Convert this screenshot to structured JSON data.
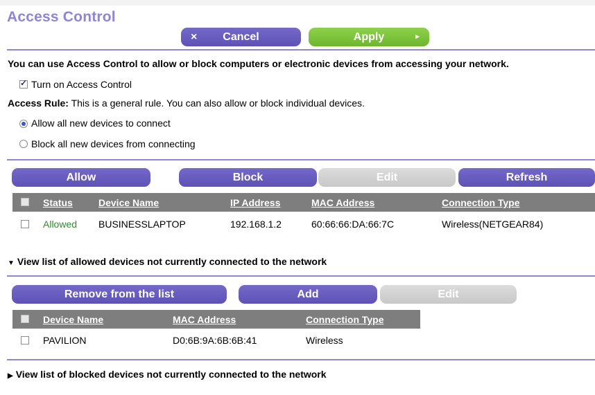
{
  "page": {
    "title": "Access Control"
  },
  "toolbar": {
    "cancel_label": "Cancel",
    "apply_label": "Apply",
    "cancel_icon": "×",
    "apply_icon": "►"
  },
  "intro": {
    "description": "You can use Access Control to allow or block computers or electronic devices from accessing your network.",
    "turn_on_label": "Turn on Access Control",
    "turn_on_checked": true,
    "rule_label": "Access Rule:",
    "rule_text": " This is a general rule. You can also allow or block individual devices.",
    "options": [
      {
        "label": "Allow all new devices to connect",
        "selected": true
      },
      {
        "label": "Block all new devices from connecting",
        "selected": false
      }
    ]
  },
  "connected": {
    "buttons": {
      "allow": "Allow",
      "block": "Block",
      "edit": "Edit",
      "refresh": "Refresh"
    },
    "columns": [
      "Status",
      "Device Name",
      "IP Address",
      "MAC Address",
      "Connection Type"
    ],
    "rows": [
      {
        "status": "Allowed",
        "device_name": "BUSINESSLAPTOP",
        "ip": "192.168.1.2",
        "mac": "60:66:66:DA:66:7C",
        "connection": "Wireless(NETGEAR84)"
      }
    ]
  },
  "allowed_not_connected": {
    "expander_label": "View list of allowed devices not currently connected to the network",
    "expanded": true,
    "buttons": {
      "remove": "Remove from the list",
      "add": "Add",
      "edit": "Edit"
    },
    "columns": [
      "Device Name",
      "MAC Address",
      "Connection Type"
    ],
    "rows": [
      {
        "device_name": "PAVILION",
        "mac": "D0:6B:9A:6B:6B:41",
        "connection": "Wireless"
      }
    ]
  },
  "blocked_not_connected": {
    "expander_label": "View list of blocked devices not currently connected to the network",
    "expanded": false
  },
  "colors": {
    "accent": "#8f84d8",
    "button_purple": "#6a5ec0",
    "button_green": "#7cc43c",
    "header_grey": "#7e7e7e",
    "allowed_green": "#2f8a2f"
  }
}
